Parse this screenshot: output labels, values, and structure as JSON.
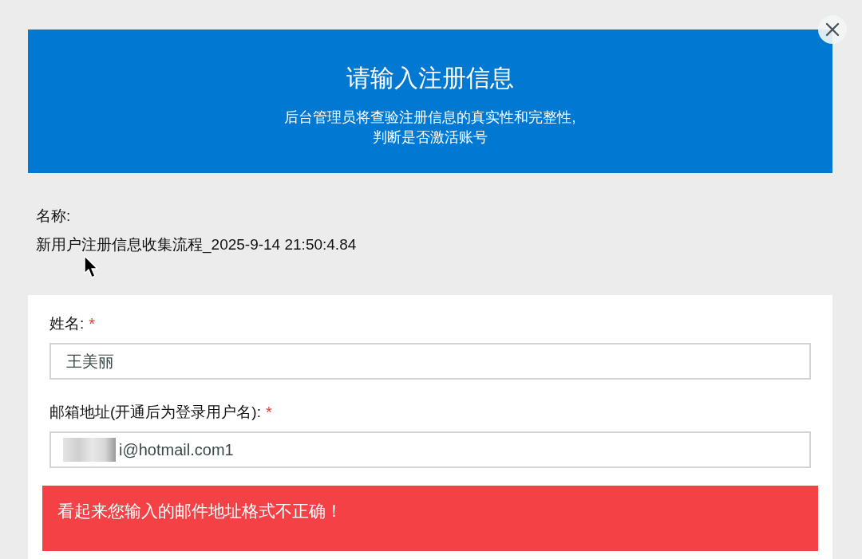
{
  "header": {
    "title": "请输入注册信息",
    "subtitle": "后台管理员将查验注册信息的真实性和完整性,\n判断是否激活账号"
  },
  "record": {
    "label": "名称:",
    "value": "新用户注册信息收集流程_2025-9-14 21:50:4.84"
  },
  "form": {
    "fields": [
      {
        "label": "姓名:",
        "required_mark": "*",
        "value": "王美丽",
        "redacted": false
      },
      {
        "label": "邮箱地址(开通后为登录用户名):",
        "required_mark": "*",
        "value": "i@hotmail.com1",
        "redacted": true
      }
    ],
    "error": "看起来您输入的邮件地址格式不正确！"
  }
}
